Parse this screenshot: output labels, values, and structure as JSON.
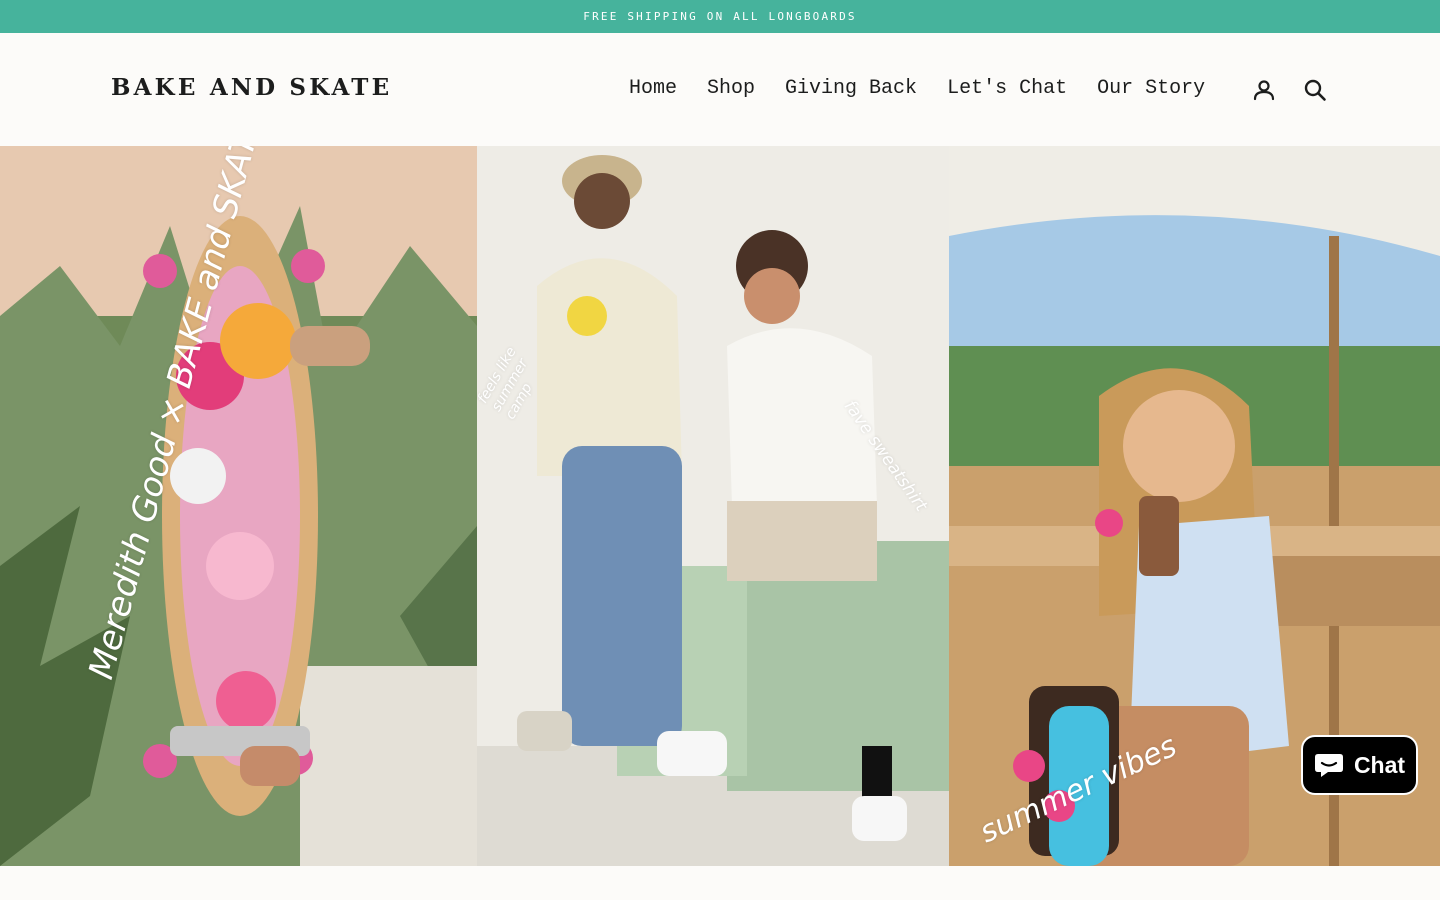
{
  "announcement": "FREE SHIPPING ON ALL LONGBOARDS",
  "header": {
    "logo": "BAKE AND SKATE",
    "nav": [
      "Home",
      "Shop",
      "Giving Back",
      "Let's Chat",
      "Our Story"
    ],
    "icons": [
      "account-icon",
      "search-icon"
    ]
  },
  "hero": {
    "panel_1": {
      "handwriting": "Meredith Good × BAKE and SKATE"
    },
    "panel_2": {
      "handwriting_left": "feels like summer camp",
      "handwriting_right": "fave sweatshirt"
    },
    "panel_3": {
      "handwriting": "summer vibes"
    }
  },
  "chat": {
    "label": "Chat",
    "icon": "chat-bubble-icon"
  },
  "colors": {
    "announcement_bg": "#46b39c",
    "page_bg": "#fcfbf9",
    "text": "#1c1d1d"
  }
}
